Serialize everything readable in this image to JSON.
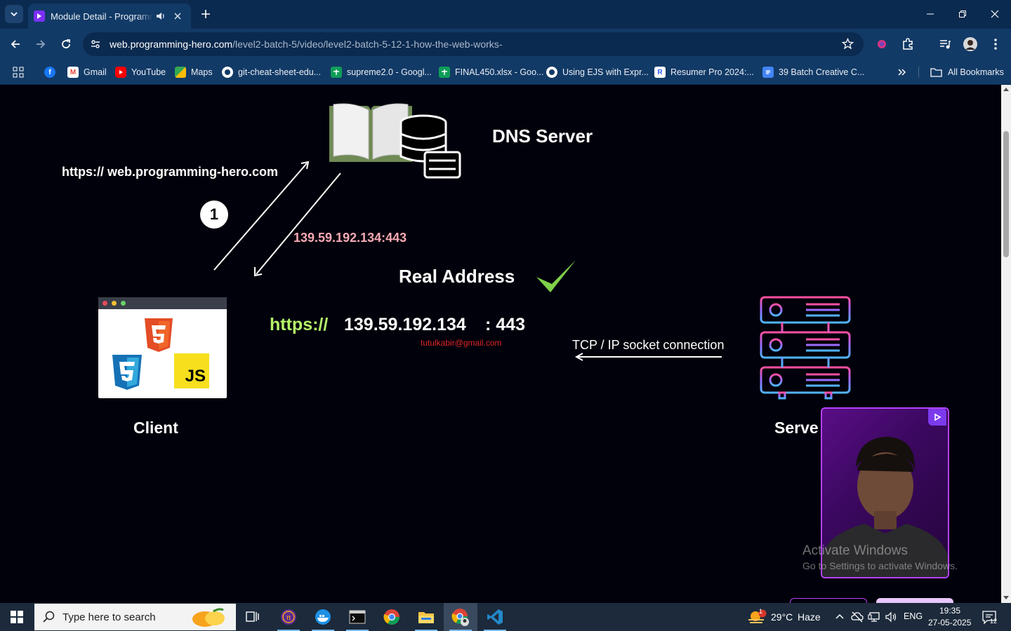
{
  "browser": {
    "tab_title": "Module Detail - Programming Hero",
    "url_host": "web.programming-hero.com",
    "url_path": "/level2-batch-5/video/level2-batch-5-12-1-how-the-web-works-",
    "bookmarks": [
      {
        "label": "",
        "icon": "facebook-icon",
        "color": "#1877f2"
      },
      {
        "label": "Gmail",
        "icon": "gmail-icon",
        "color": "#ea4335"
      },
      {
        "label": "YouTube",
        "icon": "youtube-icon",
        "color": "#ff0000"
      },
      {
        "label": "Maps",
        "icon": "maps-icon",
        "color": "#34a853"
      },
      {
        "label": "git-cheat-sheet-edu...",
        "icon": "github-icon",
        "color": "#ffffff"
      },
      {
        "label": "supreme2.0 - Googl...",
        "icon": "sheets-icon",
        "color": "#0f9d58"
      },
      {
        "label": "FINAL450.xlsx - Goo...",
        "icon": "sheets-icon",
        "color": "#0f9d58"
      },
      {
        "label": "Using EJS with Expr...",
        "icon": "github-icon",
        "color": "#ffffff"
      },
      {
        "label": "Resumer Pro 2024:...",
        "icon": "resume-icon",
        "color": "#2f5cff"
      },
      {
        "label": "39 Batch Creative C...",
        "icon": "docs-icon",
        "color": "#4285f4"
      }
    ],
    "all_bookmarks_label": "All Bookmarks"
  },
  "slide": {
    "dns_title": "DNS Server",
    "request_url": "https:// web.programming-hero.com",
    "step_number": "1",
    "resolved_ip": "139.59.192.134:443",
    "real_address_label": "Real Address",
    "address_scheme": "https://",
    "address_ip": "139.59.192.134",
    "address_port": ": 443",
    "watermark_email": "tutulkabir@gmail.com",
    "tcp_label": "TCP / IP socket connection",
    "client_label": "Client",
    "server_label": "Serve",
    "js_label": "JS"
  },
  "overlay": {
    "activate_title": "Activate Windows",
    "activate_subtitle": "Go to Settings to activate Windows."
  },
  "taskbar": {
    "search_placeholder": "Type here to search",
    "weather_temp": "29°C",
    "weather_text": "Haze",
    "weather_badge": "1",
    "language": "ENG",
    "time": "19:35",
    "date": "27-05-2025",
    "notification_count": "12"
  },
  "colors": {
    "accent_purple": "#b442ff",
    "chrome_dark": "#0b2a4f",
    "chrome_mid": "#123a66",
    "ip_pink": "#f6a9b4",
    "scheme_green": "#b5f36a"
  }
}
